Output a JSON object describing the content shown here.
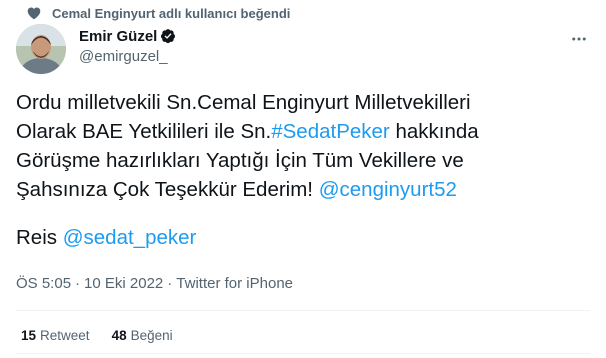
{
  "social_context": {
    "text": "Cemal Enginyurt adlı kullanıcı beğendi",
    "icon": "heart-icon"
  },
  "author": {
    "name": "Emir Güzel",
    "handle": "@emirguzel_",
    "verified_icon": "verified-badge-icon"
  },
  "more_icon": "more-horizontal-icon",
  "tweet": {
    "line1_prefix": "Ordu milletvekili Sn.Cemal Enginyurt Milletvekilleri",
    "line2_prefix": "Olarak BAE Yetkilileri ile Sn.",
    "hashtag": "#SedatPeker",
    "line2_suffix": " hakkında",
    "line3": "Görüşme hazırlıkları Yaptığı İçin Tüm Vekillere ve",
    "line4_prefix": "Şahsınıza Çok Teşekkür Ederim! ",
    "mention1": "@cenginyurt52",
    "reis_prefix": "Reis ",
    "mention2": "@sedat_peker"
  },
  "meta": {
    "time": "ÖS 5:05",
    "separator1": "·",
    "date": "10 Eki 2022",
    "separator2": "·",
    "source": "Twitter for iPhone"
  },
  "stats": {
    "retweets": {
      "count": "15",
      "label": "Retweet"
    },
    "likes": {
      "count": "48",
      "label": "Beğeni"
    }
  },
  "colors": {
    "link": "#1d9bf0",
    "secondary": "#536471",
    "text": "#0f1419",
    "divider": "#eff3f4"
  }
}
